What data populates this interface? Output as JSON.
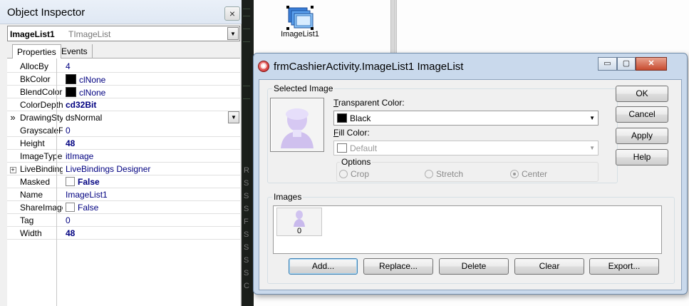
{
  "object_inspector": {
    "title": "Object Inspector",
    "close_glyph": "×",
    "component_name": "ImageList1",
    "component_type": "TImageList",
    "tabs": [
      {
        "label": "Properties",
        "active": true
      },
      {
        "label": "Events",
        "active": false
      }
    ],
    "properties": [
      {
        "name": "AllocBy",
        "value": "4",
        "style": "normal"
      },
      {
        "name": "BkColor",
        "value": "clNone",
        "style": "color"
      },
      {
        "name": "BlendColor",
        "value": "clNone",
        "style": "color"
      },
      {
        "name": "ColorDepth",
        "value": "cd32Bit",
        "style": "bold"
      },
      {
        "name": "DrawingStyle",
        "value": "dsNormal",
        "style": "selected"
      },
      {
        "name": "GrayscaleFactor",
        "value": "0",
        "style": "normal"
      },
      {
        "name": "Height",
        "value": "48",
        "style": "bold"
      },
      {
        "name": "ImageType",
        "value": "itImage",
        "style": "normal"
      },
      {
        "name": "LiveBindings",
        "value": "LiveBindings Designer",
        "style": "expand"
      },
      {
        "name": "Masked",
        "value": "False",
        "style": "checkbox-bold"
      },
      {
        "name": "Name",
        "value": "ImageList1",
        "style": "normal"
      },
      {
        "name": "ShareImages",
        "value": "False",
        "style": "checkbox"
      },
      {
        "name": "Tag",
        "value": "0",
        "style": "normal"
      },
      {
        "name": "Width",
        "value": "48",
        "style": "bold"
      }
    ],
    "selected_marker": "»"
  },
  "designer": {
    "component_label": "ImageList1",
    "gutter_chars": [
      "R",
      "S",
      "S",
      "S",
      "F",
      "S",
      "S",
      "S",
      "S",
      "C"
    ]
  },
  "dialog": {
    "title": "frmCashierActivity.ImageList1 ImageList",
    "title_icon": "delphi-icon",
    "window_buttons": {
      "minimize": "▭",
      "maximize": "▢",
      "close": "✕"
    },
    "selected_image": {
      "label": "Selected Image"
    },
    "transparent_color": {
      "label": "Transparent Color:",
      "value": "Black",
      "swatch": "#000000"
    },
    "fill_color": {
      "label": "Fill Color:",
      "value": "Default",
      "swatch": "#ffffff"
    },
    "options": {
      "label": "Options",
      "radios": [
        {
          "label": "Crop",
          "checked": false
        },
        {
          "label": "Stretch",
          "checked": false
        },
        {
          "label": "Center",
          "checked": true
        }
      ]
    },
    "images": {
      "label": "Images",
      "items": [
        {
          "index": "0"
        }
      ]
    },
    "buttons_right": {
      "ok": "OK",
      "cancel": "Cancel",
      "apply": "Apply",
      "help": "Help"
    },
    "buttons_bottom": {
      "add": "Add...",
      "replace": "Replace...",
      "delete": "Delete",
      "clear": "Clear",
      "export": "Export..."
    }
  }
}
